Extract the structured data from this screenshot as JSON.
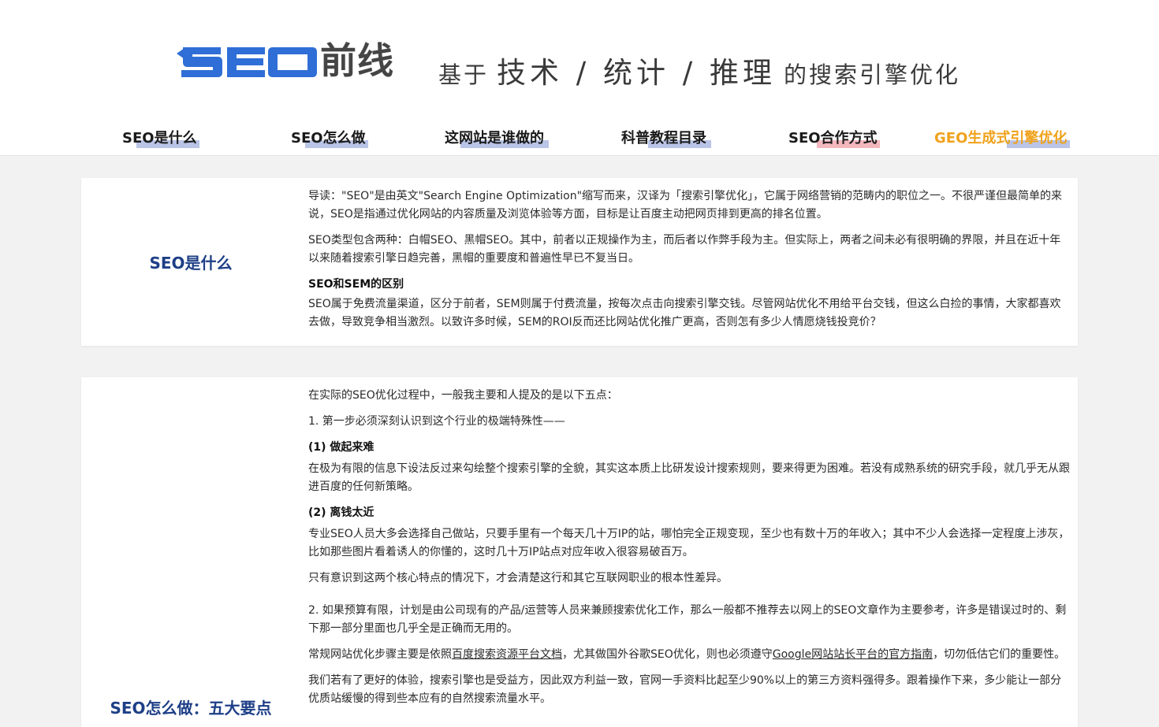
{
  "logo": {
    "brand_text": "SEO",
    "cn_text": "前线",
    "brand_color": "#2f6ed6",
    "cn_color": "#454545"
  },
  "slogan": {
    "prefix": "基于",
    "core": "技术 / 统计 / 推理",
    "suffix": "的搜索引擎优化"
  },
  "nav": {
    "items": [
      {
        "label": "SEO是什么",
        "highlight_color": "#b9c4e6",
        "text_color": "#1a1a1a"
      },
      {
        "label": "SEO怎么做",
        "highlight_color": "#b9c4e6",
        "text_color": "#1a1a1a"
      },
      {
        "label": "这网站是谁做的",
        "highlight_color": "#b9c4e6",
        "text_color": "#1a1a1a"
      },
      {
        "label": "科普教程目录",
        "highlight_color": "#b9c4e6",
        "text_color": "#1a1a1a"
      },
      {
        "label": "SEO合作方式",
        "highlight_color": "#f3b7be",
        "text_color": "#1a1a1a"
      },
      {
        "label": "GEO生成式引擎优化",
        "highlight_color": "#b9c4e6",
        "text_color": "#f0a21b"
      }
    ]
  },
  "section1": {
    "title": "SEO是什么",
    "intro": "导读：\"SEO\"是由英文\"Search Engine Optimization\"缩写而来，汉译为「搜索引擎优化」，它属于网络营销的范畴内的职位之一。不很严谨但最简单的来说，SEO是指通过优化网站的内容质量及浏览体验等方面，目标是让百度主动把网页排到更高的排名位置。",
    "types": "SEO类型包含两种：白帽SEO、黑帽SEO。其中，前者以正规操作为主，而后者以作弊手段为主。但实际上，两者之间未必有很明确的界限，并且在近十年以来随着搜索引擎日趋完善，黑帽的重要度和普遍性早已不复当日。",
    "diff_heading": "SEO和SEM的区别",
    "diff_text": "SEO属于免费流量渠道，区分于前者，SEM则属于付费流量，按每次点击向搜索引擎交钱。尽管网站优化不用给平台交钱，但这么白捡的事情，大家都喜欢去做，导致竞争相当激烈。以致许多时候，SEM的ROI反而还比网站优化推广更高，否则怎有多少人情愿烧钱投竞价？"
  },
  "section2": {
    "title": "SEO怎么做：五大要点",
    "intro": "在实际的SEO优化过程中，一般我主要和人提及的是以下五点：",
    "point1": "1. 第一步必须深刻认识到这个行业的极端特殊性——",
    "sub1_heading": "(1) 做起来难",
    "sub1_text": "在极为有限的信息下设法反过来勾绘整个搜索引擎的全貌，其实这本质上比研发设计搜索规则，要来得更为困难。若没有成熟系统的研究手段，就几乎无从跟进百度的任何新策略。",
    "sub2_heading": "(2) 离钱太近",
    "sub2_text": "专业SEO人员大多会选择自己做站，只要手里有一个每天几十万IP的站，哪怕完全正规变现，至少也有数十万的年收入；其中不少人会选择一定程度上涉灰，比如那些图片看着诱人的你懂的，这时几十万IP站点对应年收入很容易破百万。",
    "sub_conclusion": "只有意识到这两个核心特点的情况下，才会清楚这行和其它互联网职业的根本性差异。",
    "point2": "2. 如果预算有限，计划是由公司现有的产品/运营等人员来兼顾搜索优化工作，那么一般都不推荐去以网上的SEO文章作为主要参考，许多是错误过时的、剩下那一部分里面也几乎全是正确而无用的。",
    "steps_prefix": "常规网站优化步骤主要是依照",
    "steps_link1": "百度搜索资源平台文档",
    "steps_middle": "，尤其做国外谷歌SEO优化，则也必须遵守",
    "steps_link2": "Google网站站长平台的官方指南",
    "steps_suffix": "，切勿低估它们的重要性。",
    "experience": "我们若有了更好的体验，搜索引擎也是受益方，因此双方利益一致，官网一手资料比起至少90%以上的第三方资料强得多。跟着操作下来，多少能让一部分优质站缓慢的得到些本应有的自然搜索流量水平。"
  }
}
